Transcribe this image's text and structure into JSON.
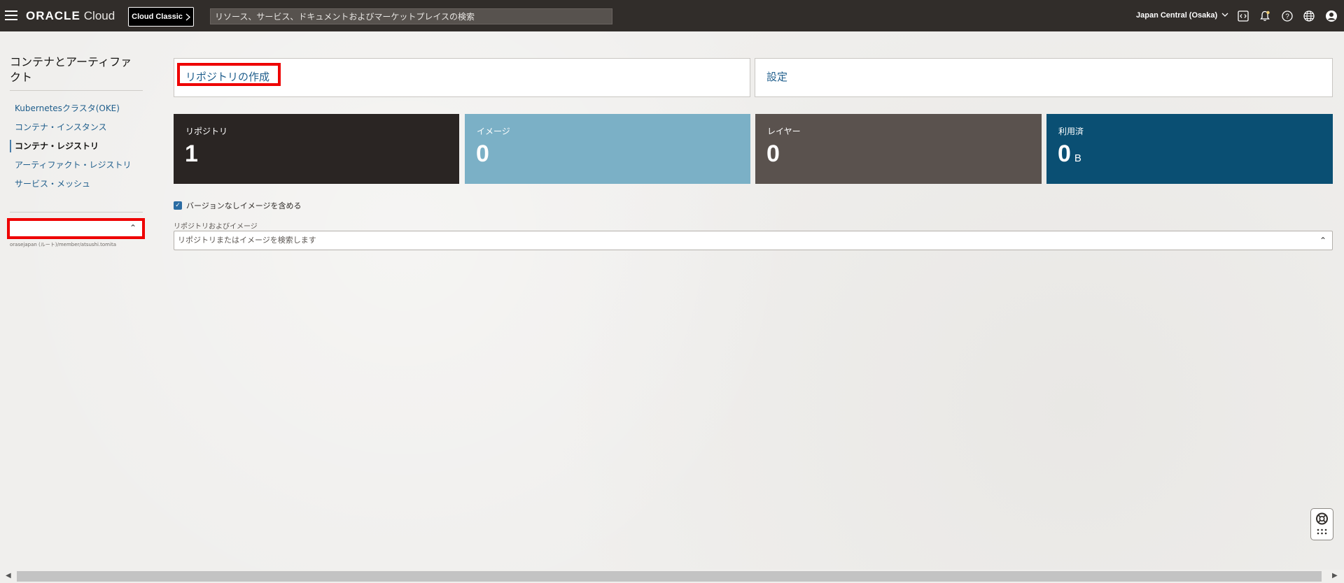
{
  "header": {
    "brand": "ORACLE",
    "product": "Cloud",
    "classic_button": "Cloud Classic",
    "search_placeholder": "リソース、サービス、ドキュメントおよびマーケットプレイスの検索",
    "region": "Japan Central (Osaka)",
    "icons": [
      "menu-icon",
      "chevron-right-icon",
      "chevron-down-icon",
      "code-editor-icon",
      "bell-icon",
      "help-icon",
      "globe-icon",
      "user-avatar-icon"
    ]
  },
  "sidebar": {
    "title": "コンテナとアーティファクト",
    "items": [
      {
        "label": "Kubernetesクラスタ(OKE)",
        "active": false
      },
      {
        "label": "コンテナ・インスタンス",
        "active": false
      },
      {
        "label": "コンテナ・レジストリ",
        "active": true
      },
      {
        "label": "アーティファクト・レジストリ",
        "active": false
      },
      {
        "label": "サービス・メッシュ",
        "active": false
      }
    ],
    "compartment_value": "",
    "compartment_path": "orasejapan (ルート)/member/atsushi.tomita"
  },
  "actions": {
    "create_repository": "リポジトリの作成",
    "settings": "設定"
  },
  "metrics": [
    {
      "label": "リポジトリ",
      "value": "1",
      "unit": "",
      "color": "#2a2523"
    },
    {
      "label": "イメージ",
      "value": "0",
      "unit": "",
      "color": "#7bb0c6"
    },
    {
      "label": "レイヤー",
      "value": "0",
      "unit": "",
      "color": "#5a524e"
    },
    {
      "label": "利用済",
      "value": "0",
      "unit": "B",
      "color": "#0a4f73"
    }
  ],
  "filters": {
    "include_unversioned_label": "バージョンなしイメージを含める",
    "include_unversioned_checked": true,
    "repo_field_label": "リポジトリおよびイメージ",
    "repo_placeholder": "リポジトリまたはイメージを検索します"
  }
}
